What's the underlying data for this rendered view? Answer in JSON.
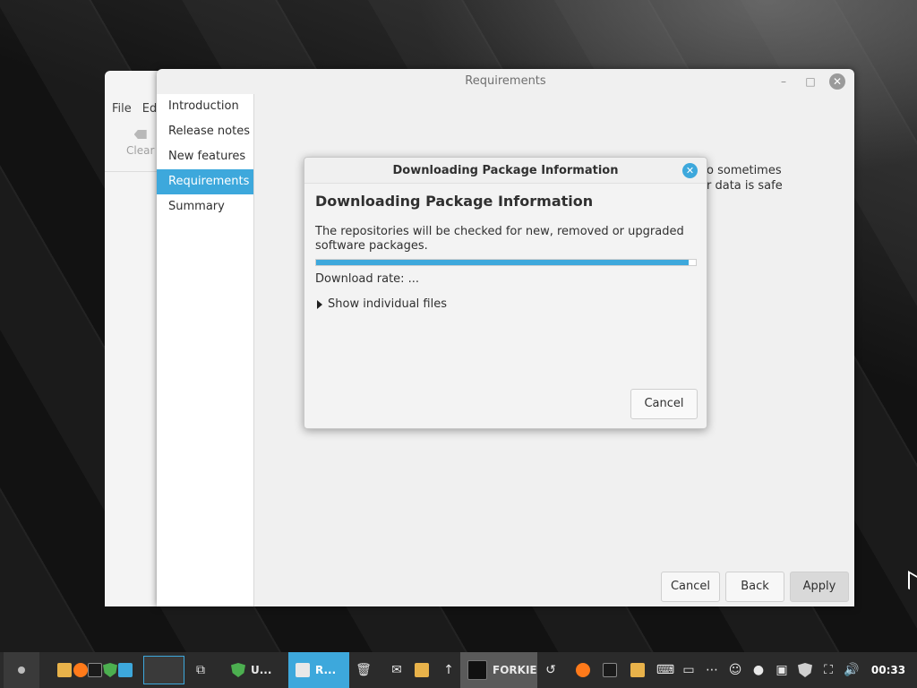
{
  "background_window": {
    "menu": [
      "File",
      "Ed"
    ],
    "clear_label": "Clear"
  },
  "main_window": {
    "title": "Requirements",
    "sidebar": [
      {
        "label": "Introduction",
        "active": false
      },
      {
        "label": "Release notes",
        "active": false
      },
      {
        "label": "New features",
        "active": false
      },
      {
        "label": "Requirements",
        "active": true
      },
      {
        "label": "Summary",
        "active": false
      }
    ],
    "partial_text_line1": "o sometimes",
    "partial_text_line2": "r data is safe",
    "buttons": {
      "cancel": "Cancel",
      "back": "Back",
      "apply": "Apply"
    }
  },
  "dialog": {
    "title": "Downloading Package Information",
    "heading": "Downloading Package Information",
    "description": "The repositories will be checked for new, removed or upgraded software packages.",
    "progress": 0.98,
    "download_rate": "Download rate: ...",
    "expander_label": "Show individual files",
    "cancel_label": "Cancel",
    "close_icon": "close-icon"
  },
  "taskbar": {
    "tasks": [
      {
        "label": "U...",
        "icon": "shield-icon"
      },
      {
        "label": "R...",
        "icon": "download-icon"
      },
      {
        "label": "FORKIE",
        "icon": "forkie-icon"
      }
    ],
    "clock": "00:33"
  },
  "colors": {
    "accent": "#3da8dc",
    "taskbar": "#2b2b2b",
    "window_bg": "#f0f0f0"
  }
}
